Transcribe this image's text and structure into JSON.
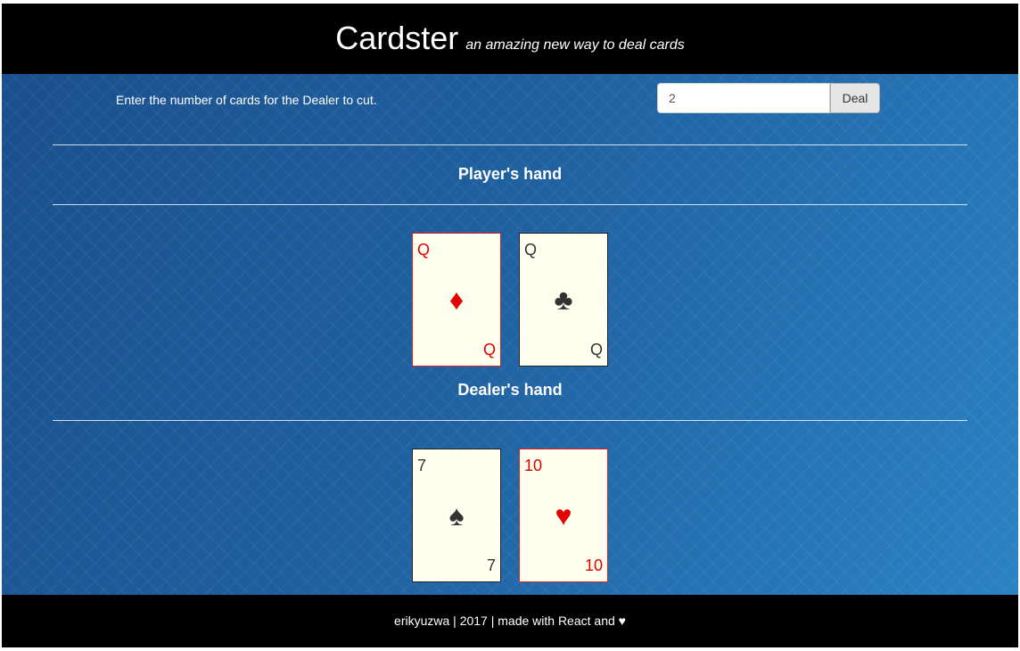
{
  "header": {
    "title": "Cardster",
    "tagline": "an amazing new way to deal cards"
  },
  "controls": {
    "instruction": "Enter the number of cards for the Dealer to cut.",
    "cut_value": "2",
    "deal_label": "Deal"
  },
  "player": {
    "title": "Player's hand",
    "cards": [
      {
        "rank": "Q",
        "suit": "♦",
        "suit_name": "diamonds",
        "color": "red"
      },
      {
        "rank": "Q",
        "suit": "♣",
        "suit_name": "clubs",
        "color": "black"
      }
    ]
  },
  "dealer": {
    "title": "Dealer's hand",
    "cards": [
      {
        "rank": "7",
        "suit": "♠",
        "suit_name": "spades",
        "color": "black"
      },
      {
        "rank": "10",
        "suit": "♥",
        "suit_name": "hearts",
        "color": "red"
      }
    ]
  },
  "footer": {
    "credit": "erikyuzwa | 2017 | made with React and ♥"
  },
  "colors": {
    "header_bg": "#000000",
    "felt": "#1f609f",
    "card_face": "#fffff0",
    "red_suit": "#e50000",
    "black_suit": "#333333"
  }
}
